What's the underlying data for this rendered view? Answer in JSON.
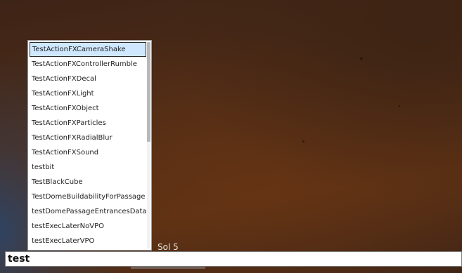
{
  "hud": {
    "sol_label": "Sol 5"
  },
  "autocomplete": {
    "selected_index": 0,
    "items": [
      "TestActionFXCameraShake",
      "TestActionFXControllerRumble",
      "TestActionFXDecal",
      "TestActionFXLight",
      "TestActionFXObject",
      "TestActionFXParticles",
      "TestActionFXRadialBlur",
      "TestActionFXSound",
      "testbit",
      "TestBlackCube",
      "TestDomeBuildabilityForPassage",
      "testDomePassageEntrancesData",
      "testExecLaterNoVPO",
      "testExecLaterVPO"
    ]
  },
  "console": {
    "input_value": "test"
  },
  "colors": {
    "selected_item_bg": "#cfe8ff",
    "background_ground": "#4d2b16"
  }
}
